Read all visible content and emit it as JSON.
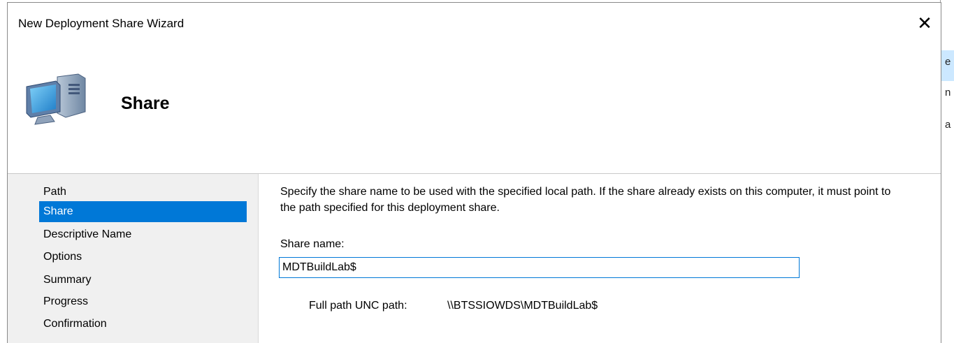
{
  "window": {
    "title": "New Deployment Share Wizard",
    "close_glyph": "✕"
  },
  "header": {
    "icon": "computer-icon",
    "title": "Share"
  },
  "nav": {
    "items": [
      {
        "label": "Path",
        "selected": false
      },
      {
        "label": "Share",
        "selected": true
      },
      {
        "label": "Descriptive Name",
        "selected": false
      },
      {
        "label": "Options",
        "selected": false
      },
      {
        "label": "Summary",
        "selected": false
      },
      {
        "label": "Progress",
        "selected": false
      },
      {
        "label": "Confirmation",
        "selected": false
      }
    ]
  },
  "content": {
    "description": "Specify the share name to be used with the specified local path.  If the share already exists on this computer, it must point to the path specified for this deployment share.",
    "share_name_label": "Share name:",
    "share_name_value": "MDTBuildLab$",
    "unc_label": "Full path UNC path:",
    "unc_value": "\\\\BTSSIOWDS\\MDTBuildLab$"
  },
  "background_window": {
    "visible_chars": [
      "e",
      "n",
      "a"
    ]
  },
  "colors": {
    "selection": "#0078d7",
    "panel_bg": "#f0f0f0",
    "input_border": "#0078d7"
  }
}
